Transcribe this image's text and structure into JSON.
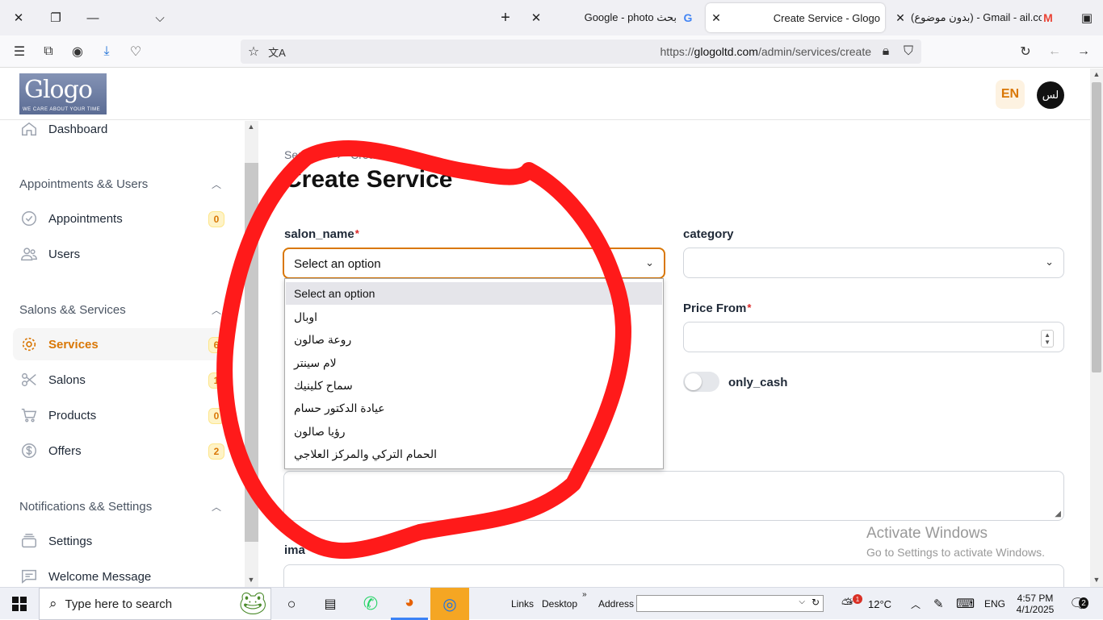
{
  "browser": {
    "tabs": [
      {
        "title": "Google - photo بحث",
        "favicon": "G",
        "active": false
      },
      {
        "title": "Create Service - Glogo",
        "favicon": "",
        "active": true
      },
      {
        "title": "(بدون موضوع) - Gmail - ail.com",
        "favicon": "M",
        "active": false
      }
    ],
    "url_prefix": "https://",
    "url_domain": "glogoltd.com",
    "url_path": "/admin/services/create"
  },
  "header": {
    "logo_name": "Glogo",
    "logo_tagline": "WE CARE ABOUT YOUR TIME",
    "lang": "EN",
    "avatar": "لس"
  },
  "sidebar": {
    "dashboard": "Dashboard",
    "groups": [
      {
        "title": "Appointments && Users"
      },
      {
        "title": "Salons && Services"
      },
      {
        "title": "Notifications && Settings"
      }
    ],
    "items": [
      {
        "label": "Appointments",
        "badge": "0"
      },
      {
        "label": "Users"
      },
      {
        "label": "Services",
        "badge": "6"
      },
      {
        "label": "Salons",
        "badge": "1"
      },
      {
        "label": "Products",
        "badge": "0"
      },
      {
        "label": "Offers",
        "badge": "2"
      },
      {
        "label": "Settings"
      },
      {
        "label": "Welcome Message"
      }
    ]
  },
  "main": {
    "breadcrumb": [
      "Services",
      "Create"
    ],
    "title": "Create Service",
    "fields": {
      "salon_name": {
        "label": "salon_name",
        "required_mark": "*",
        "value": "Select an option"
      },
      "category": {
        "label": "category",
        "value": ""
      },
      "price_from": {
        "label": "Price From",
        "required_mark": "*"
      },
      "only_cash": {
        "label": "only_cash"
      },
      "image_label": "ima"
    },
    "dropdown_options": [
      "Select an option",
      "اوبال",
      "روعة صالون",
      "لام سينتر",
      "سماح كلينيك",
      "عيادة الدكتور حسام",
      "رؤيا صالون",
      "الحمام التركي والمركز العلاجي"
    ]
  },
  "watermark": {
    "line1": "Activate Windows",
    "line2": "Go to Settings to activate Windows."
  },
  "taskbar": {
    "search_placeholder": "Type here to search",
    "links": "Links",
    "desktop": "Desktop",
    "address": "Address",
    "temperature": "12°C",
    "weather_badge": "1",
    "language": "ENG",
    "time": "4:57 PM",
    "date": "4/1/2025",
    "notifications": "2"
  }
}
